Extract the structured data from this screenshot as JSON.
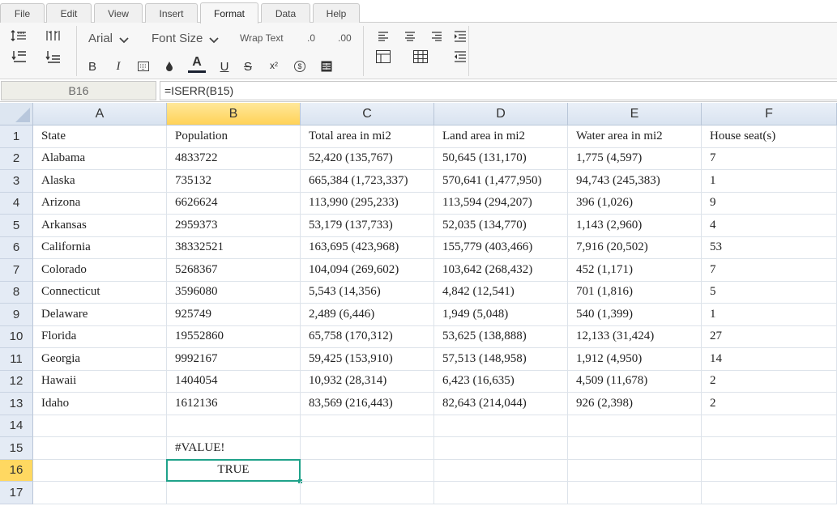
{
  "menu_tabs": [
    "File",
    "Edit",
    "View",
    "Insert",
    "Format",
    "Data",
    "Help"
  ],
  "active_tab": "Format",
  "toolbar": {
    "font_name": "Arial",
    "font_size_label": "Font Size",
    "wrap_text_label": "Wrap Text",
    "decrease_decimal_label": ".0",
    "increase_decimal_label": ".00",
    "bold_label": "B",
    "italic_label": "I",
    "font_color_label": "A",
    "underline_label": "U",
    "strike_label": "S",
    "superscript_label": "x²",
    "currency_label": "$"
  },
  "formula_bar": {
    "name_box": "B16",
    "formula": "=ISERR(B15)"
  },
  "sheet": {
    "columns": [
      "A",
      "B",
      "C",
      "D",
      "E",
      "F"
    ],
    "selected_column": "B",
    "row_numbers": [
      "1",
      "2",
      "3",
      "4",
      "5",
      "6",
      "7",
      "8",
      "9",
      "10",
      "11",
      "12",
      "13",
      "14",
      "15",
      "16",
      "17"
    ],
    "selected_row": "16",
    "rows": [
      [
        "State",
        "Population",
        "Total area in mi2",
        "Land area in mi2",
        "Water area in mi2",
        "House seat(s)"
      ],
      [
        "Alabama",
        "4833722",
        "52,420 (135,767)",
        "50,645 (131,170)",
        "1,775 (4,597)",
        "7"
      ],
      [
        "Alaska",
        "735132",
        "665,384 (1,723,337)",
        "570,641 (1,477,950)",
        "94,743 (245,383)",
        "1"
      ],
      [
        "Arizona",
        "6626624",
        "113,990 (295,233)",
        "113,594 (294,207)",
        "396 (1,026)",
        "9"
      ],
      [
        "Arkansas",
        "2959373",
        "53,179 (137,733)",
        "52,035 (134,770)",
        "1,143 (2,960)",
        "4"
      ],
      [
        "California",
        "38332521",
        "163,695 (423,968)",
        "155,779 (403,466)",
        "7,916 (20,502)",
        "53"
      ],
      [
        "Colorado",
        "5268367",
        "104,094 (269,602)",
        "103,642 (268,432)",
        "452 (1,171)",
        "7"
      ],
      [
        "Connecticut",
        "3596080",
        "5,543 (14,356)",
        "4,842 (12,541)",
        "701 (1,816)",
        "5"
      ],
      [
        "Delaware",
        "925749",
        "2,489 (6,446)",
        "1,949 (5,048)",
        "540 (1,399)",
        "1"
      ],
      [
        "Florida",
        "19552860",
        "65,758 (170,312)",
        "53,625 (138,888)",
        "12,133 (31,424)",
        "27"
      ],
      [
        "Georgia",
        "9992167",
        "59,425 (153,910)",
        "57,513 (148,958)",
        "1,912 (4,950)",
        "14"
      ],
      [
        "Hawaii",
        "1404054",
        "10,932 (28,314)",
        "6,423 (16,635)",
        "4,509 (11,678)",
        "2"
      ],
      [
        "Idaho",
        "1612136",
        "83,569 (216,443)",
        "82,643 (214,044)",
        "926 (2,398)",
        "2"
      ],
      [
        "",
        "",
        "",
        "",
        "",
        ""
      ],
      [
        "",
        "#VALUE!",
        "",
        "",
        "",
        ""
      ],
      [
        "",
        "TRUE",
        "",
        "",
        "",
        ""
      ],
      [
        "",
        "",
        "",
        "",
        "",
        ""
      ]
    ]
  },
  "colors": {
    "selection_outline": "#1fa28a",
    "selected_header": "#ffd861"
  },
  "icons": [
    "row-height-icon",
    "column-width-icon",
    "indent-increase-icon",
    "indent-decrease-icon",
    "chevron-down-icon",
    "borders-icon",
    "fill-color-icon",
    "merge-cells-icon",
    "align-left-icon",
    "align-center-icon",
    "align-right-icon",
    "table-icon",
    "cell-borders-icon"
  ]
}
